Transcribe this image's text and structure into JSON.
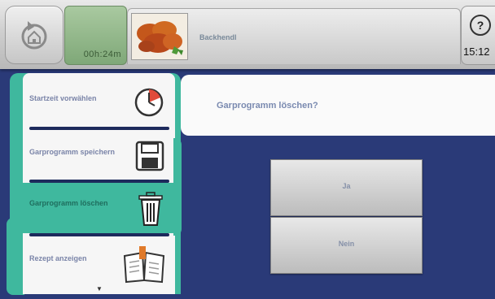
{
  "header": {
    "timer": "00h:24m",
    "recipe_title": "Backhendl",
    "clock": "15:12",
    "help_symbol": "?"
  },
  "menu": {
    "items": [
      {
        "label": "Startzeit vorwählen",
        "icon": "timer-icon",
        "active": false
      },
      {
        "label": "Garprogramm speichern",
        "icon": "floppy-disk-icon",
        "active": false
      },
      {
        "label": "Garprogramm löschen",
        "icon": "trash-icon",
        "active": true
      },
      {
        "label": "Rezept anzeigen",
        "icon": "open-book-icon",
        "active": false
      }
    ],
    "scroll_indicator": "▼"
  },
  "dialog": {
    "question": "Garprogramm löschen?",
    "yes_label": "Ja",
    "no_label": "Nein"
  },
  "colors": {
    "accent_teal": "#3fb89e",
    "background_blue": "#2a3a78",
    "timer_green": "#8fb888"
  }
}
